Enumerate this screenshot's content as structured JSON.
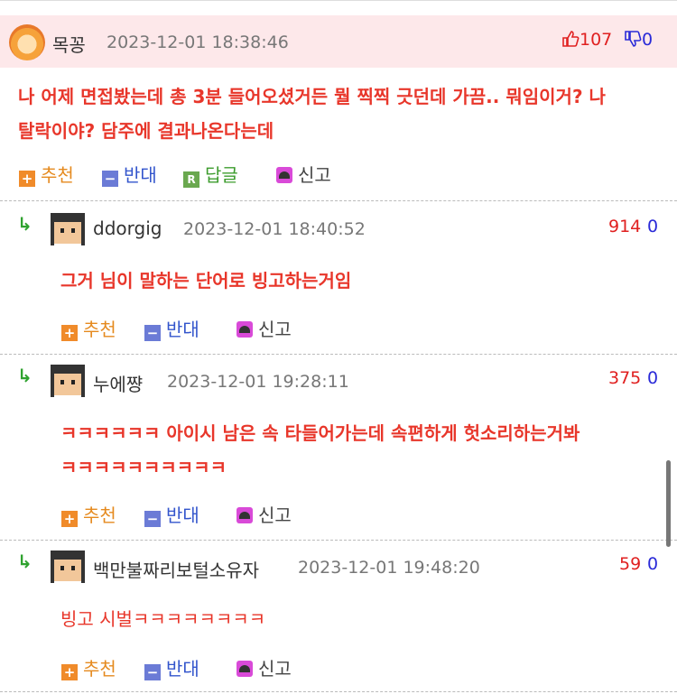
{
  "main_post": {
    "author": "목꽁",
    "date": "2023-12-01 18:38:46",
    "upvotes": "107",
    "downvotes": "0",
    "body_line1": "나 어제 면접봤는데 총 3분 들어오셨거든 뭘 찍찍 긋던데 가끔.. 뭐임이거? 나",
    "body_line2": "탈락이야? 담주에 결과나온다는데",
    "actions": {
      "up": "추천",
      "down": "반대",
      "reply": "답글",
      "report": "신고"
    },
    "up_icon": "+",
    "down_icon": "−",
    "reply_icon": "R"
  },
  "replies": [
    {
      "author": "ddorgig",
      "date": "2023-12-01 18:40:52",
      "upvotes": "914",
      "downvotes": "0",
      "body_line1": "그거 님이 말하는 단어로 빙고하는거임",
      "body_line2": "",
      "actions": {
        "up": "추천",
        "down": "반대",
        "report": "신고"
      }
    },
    {
      "author": "누에쨩",
      "date": "2023-12-01 19:28:11",
      "upvotes": "375",
      "downvotes": "0",
      "body_line1": "ㅋㅋㅋㅋㅋㅋ 아이시 남은 속 타들어가는데 속편하게 헛소리하는거봐",
      "body_line2": "ㅋㅋㅋㅋㅋㅋㅋㅋㅋㅋ",
      "actions": {
        "up": "추천",
        "down": "반대",
        "report": "신고"
      }
    },
    {
      "author": "백만불짜리보털소유자",
      "date": "2023-12-01 19:48:20",
      "upvotes": "59",
      "downvotes": "0",
      "body_line1": "빙고 시벌ㅋㅋㅋㅋㅋㅋㅋㅋ",
      "body_line2": "",
      "actions": {
        "up": "추천",
        "down": "반대",
        "report": "신고"
      }
    }
  ],
  "icons": {
    "reply_arrow": "reply-arrow-icon",
    "thumbs_up": "thumbs-up-icon",
    "thumbs_down": "thumbs-down-icon",
    "report": "siren-icon"
  },
  "colors": {
    "body_text": "#e8362a",
    "upvote": "#e02020",
    "downvote": "#2a2ad8",
    "main_bg": "#fde8ea"
  }
}
